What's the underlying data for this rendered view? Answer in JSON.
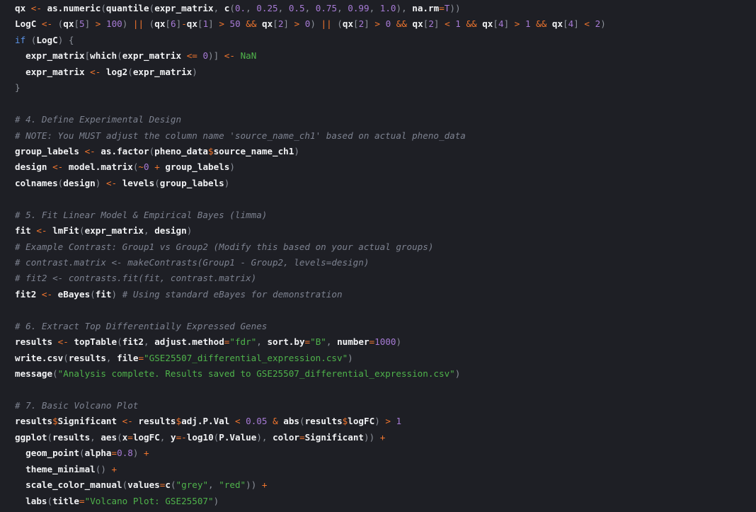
{
  "theme": {
    "background": "#1e1f25",
    "default": "#f2f3f5",
    "punctuation": "#8c919a",
    "operator": "#f2762e",
    "number": "#a77bd6",
    "string": "#4fb34b",
    "keyword": "#5b94e8",
    "comment": "#7d8290"
  },
  "lines": [
    [
      [
        "d",
        "qx "
      ],
      [
        "o",
        "<-"
      ],
      [
        "d",
        " as.numeric"
      ],
      [
        "p",
        "("
      ],
      [
        "d",
        "quantile"
      ],
      [
        "p",
        "("
      ],
      [
        "d",
        "expr_matrix"
      ],
      [
        "p",
        ", "
      ],
      [
        "d",
        "c"
      ],
      [
        "p",
        "("
      ],
      [
        "n",
        "0."
      ],
      [
        "p",
        ", "
      ],
      [
        "n",
        "0.25"
      ],
      [
        "p",
        ", "
      ],
      [
        "n",
        "0.5"
      ],
      [
        "p",
        ", "
      ],
      [
        "n",
        "0.75"
      ],
      [
        "p",
        ", "
      ],
      [
        "n",
        "0.99"
      ],
      [
        "p",
        ", "
      ],
      [
        "n",
        "1.0"
      ],
      [
        "p",
        "), "
      ],
      [
        "d",
        "na.rm"
      ],
      [
        "o",
        "="
      ],
      [
        "n",
        "T"
      ],
      [
        "p",
        "))"
      ]
    ],
    [
      [
        "d",
        "LogC "
      ],
      [
        "o",
        "<-"
      ],
      [
        "p",
        " ("
      ],
      [
        "d",
        "qx"
      ],
      [
        "p",
        "["
      ],
      [
        "n",
        "5"
      ],
      [
        "p",
        "] "
      ],
      [
        "o",
        ">"
      ],
      [
        "p",
        " "
      ],
      [
        "n",
        "100"
      ],
      [
        "p",
        ") "
      ],
      [
        "o",
        "||"
      ],
      [
        "p",
        " ("
      ],
      [
        "d",
        "qx"
      ],
      [
        "p",
        "["
      ],
      [
        "n",
        "6"
      ],
      [
        "p",
        "]"
      ],
      [
        "o",
        "-"
      ],
      [
        "d",
        "qx"
      ],
      [
        "p",
        "["
      ],
      [
        "n",
        "1"
      ],
      [
        "p",
        "] "
      ],
      [
        "o",
        ">"
      ],
      [
        "p",
        " "
      ],
      [
        "n",
        "50"
      ],
      [
        "p",
        " "
      ],
      [
        "o",
        "&&"
      ],
      [
        "p",
        " "
      ],
      [
        "d",
        "qx"
      ],
      [
        "p",
        "["
      ],
      [
        "n",
        "2"
      ],
      [
        "p",
        "] "
      ],
      [
        "o",
        ">"
      ],
      [
        "p",
        " "
      ],
      [
        "n",
        "0"
      ],
      [
        "p",
        ") "
      ],
      [
        "o",
        "||"
      ],
      [
        "p",
        " ("
      ],
      [
        "d",
        "qx"
      ],
      [
        "p",
        "["
      ],
      [
        "n",
        "2"
      ],
      [
        "p",
        "] "
      ],
      [
        "o",
        ">"
      ],
      [
        "p",
        " "
      ],
      [
        "n",
        "0"
      ],
      [
        "p",
        " "
      ],
      [
        "o",
        "&&"
      ],
      [
        "p",
        " "
      ],
      [
        "d",
        "qx"
      ],
      [
        "p",
        "["
      ],
      [
        "n",
        "2"
      ],
      [
        "p",
        "] "
      ],
      [
        "o",
        "<"
      ],
      [
        "p",
        " "
      ],
      [
        "n",
        "1"
      ],
      [
        "p",
        " "
      ],
      [
        "o",
        "&&"
      ],
      [
        "p",
        " "
      ],
      [
        "d",
        "qx"
      ],
      [
        "p",
        "["
      ],
      [
        "n",
        "4"
      ],
      [
        "p",
        "] "
      ],
      [
        "o",
        ">"
      ],
      [
        "p",
        " "
      ],
      [
        "n",
        "1"
      ],
      [
        "p",
        " "
      ],
      [
        "o",
        "&&"
      ],
      [
        "p",
        " "
      ],
      [
        "d",
        "qx"
      ],
      [
        "p",
        "["
      ],
      [
        "n",
        "4"
      ],
      [
        "p",
        "] "
      ],
      [
        "o",
        "<"
      ],
      [
        "p",
        " "
      ],
      [
        "n",
        "2"
      ],
      [
        "p",
        ")"
      ]
    ],
    [
      [
        "k",
        "if"
      ],
      [
        "p",
        " ("
      ],
      [
        "d",
        "LogC"
      ],
      [
        "p",
        ") {"
      ]
    ],
    [
      [
        "d",
        "  expr_matrix"
      ],
      [
        "p",
        "["
      ],
      [
        "d",
        "which"
      ],
      [
        "p",
        "("
      ],
      [
        "d",
        "expr_matrix "
      ],
      [
        "o",
        "<="
      ],
      [
        "p",
        " "
      ],
      [
        "n",
        "0"
      ],
      [
        "p",
        ")] "
      ],
      [
        "o",
        "<-"
      ],
      [
        "p",
        " "
      ],
      [
        "s",
        "NaN"
      ]
    ],
    [
      [
        "d",
        "  expr_matrix "
      ],
      [
        "o",
        "<-"
      ],
      [
        "d",
        " log2"
      ],
      [
        "p",
        "("
      ],
      [
        "d",
        "expr_matrix"
      ],
      [
        "p",
        ")"
      ]
    ],
    [
      [
        "p",
        "}"
      ]
    ],
    [],
    [
      [
        "c",
        "# 4. Define Experimental Design"
      ]
    ],
    [
      [
        "c",
        "# NOTE: You MUST adjust the column name 'source_name_ch1' based on actual pheno_data"
      ]
    ],
    [
      [
        "d",
        "group_labels "
      ],
      [
        "o",
        "<-"
      ],
      [
        "d",
        " as.factor"
      ],
      [
        "p",
        "("
      ],
      [
        "d",
        "pheno_data"
      ],
      [
        "o",
        "$"
      ],
      [
        "d",
        "source_name_ch1"
      ],
      [
        "p",
        ")"
      ]
    ],
    [
      [
        "d",
        "design "
      ],
      [
        "o",
        "<-"
      ],
      [
        "d",
        " model.matrix"
      ],
      [
        "p",
        "("
      ],
      [
        "o",
        "~"
      ],
      [
        "n",
        "0"
      ],
      [
        "p",
        " "
      ],
      [
        "o",
        "+"
      ],
      [
        "p",
        " "
      ],
      [
        "d",
        "group_labels"
      ],
      [
        "p",
        ")"
      ]
    ],
    [
      [
        "d",
        "colnames"
      ],
      [
        "p",
        "("
      ],
      [
        "d",
        "design"
      ],
      [
        "p",
        ") "
      ],
      [
        "o",
        "<-"
      ],
      [
        "d",
        " levels"
      ],
      [
        "p",
        "("
      ],
      [
        "d",
        "group_labels"
      ],
      [
        "p",
        ")"
      ]
    ],
    [],
    [
      [
        "c",
        "# 5. Fit Linear Model & Empirical Bayes (limma)"
      ]
    ],
    [
      [
        "d",
        "fit "
      ],
      [
        "o",
        "<-"
      ],
      [
        "d",
        " lmFit"
      ],
      [
        "p",
        "("
      ],
      [
        "d",
        "expr_matrix"
      ],
      [
        "p",
        ", "
      ],
      [
        "d",
        "design"
      ],
      [
        "p",
        ")"
      ]
    ],
    [
      [
        "c",
        "# Example Contrast: Group1 vs Group2 (Modify this based on your actual groups)"
      ]
    ],
    [
      [
        "c",
        "# contrast.matrix <- makeContrasts(Group1 - Group2, levels=design)"
      ]
    ],
    [
      [
        "c",
        "# fit2 <- contrasts.fit(fit, contrast.matrix)"
      ]
    ],
    [
      [
        "d",
        "fit2 "
      ],
      [
        "o",
        "<-"
      ],
      [
        "d",
        " eBayes"
      ],
      [
        "p",
        "("
      ],
      [
        "d",
        "fit"
      ],
      [
        "p",
        ") "
      ],
      [
        "c",
        "# Using standard eBayes for demonstration"
      ]
    ],
    [],
    [
      [
        "c",
        "# 6. Extract Top Differentially Expressed Genes"
      ]
    ],
    [
      [
        "d",
        "results "
      ],
      [
        "o",
        "<-"
      ],
      [
        "d",
        " topTable"
      ],
      [
        "p",
        "("
      ],
      [
        "d",
        "fit2"
      ],
      [
        "p",
        ", "
      ],
      [
        "d",
        "adjust.method"
      ],
      [
        "o",
        "="
      ],
      [
        "s",
        "\"fdr\""
      ],
      [
        "p",
        ", "
      ],
      [
        "d",
        "sort.by"
      ],
      [
        "o",
        "="
      ],
      [
        "s",
        "\"B\""
      ],
      [
        "p",
        ", "
      ],
      [
        "d",
        "number"
      ],
      [
        "o",
        "="
      ],
      [
        "n",
        "1000"
      ],
      [
        "p",
        ")"
      ]
    ],
    [
      [
        "d",
        "write.csv"
      ],
      [
        "p",
        "("
      ],
      [
        "d",
        "results"
      ],
      [
        "p",
        ", "
      ],
      [
        "d",
        "file"
      ],
      [
        "o",
        "="
      ],
      [
        "s",
        "\"GSE25507_differential_expression.csv\""
      ],
      [
        "p",
        ")"
      ]
    ],
    [
      [
        "d",
        "message"
      ],
      [
        "p",
        "("
      ],
      [
        "s",
        "\"Analysis complete. Results saved to GSE25507_differential_expression.csv\""
      ],
      [
        "p",
        ")"
      ]
    ],
    [],
    [
      [
        "c",
        "# 7. Basic Volcano Plot"
      ]
    ],
    [
      [
        "d",
        "results"
      ],
      [
        "o",
        "$"
      ],
      [
        "d",
        "Significant "
      ],
      [
        "o",
        "<-"
      ],
      [
        "d",
        " results"
      ],
      [
        "o",
        "$"
      ],
      [
        "d",
        "adj.P.Val "
      ],
      [
        "o",
        "<"
      ],
      [
        "p",
        " "
      ],
      [
        "n",
        "0.05"
      ],
      [
        "p",
        " "
      ],
      [
        "o",
        "&"
      ],
      [
        "d",
        " abs"
      ],
      [
        "p",
        "("
      ],
      [
        "d",
        "results"
      ],
      [
        "o",
        "$"
      ],
      [
        "d",
        "logFC"
      ],
      [
        "p",
        ") "
      ],
      [
        "o",
        ">"
      ],
      [
        "p",
        " "
      ],
      [
        "n",
        "1"
      ]
    ],
    [
      [
        "d",
        "ggplot"
      ],
      [
        "p",
        "("
      ],
      [
        "d",
        "results"
      ],
      [
        "p",
        ", "
      ],
      [
        "d",
        "aes"
      ],
      [
        "p",
        "("
      ],
      [
        "d",
        "x"
      ],
      [
        "o",
        "="
      ],
      [
        "d",
        "logFC"
      ],
      [
        "p",
        ", "
      ],
      [
        "d",
        "y"
      ],
      [
        "o",
        "=-"
      ],
      [
        "d",
        "log10"
      ],
      [
        "p",
        "("
      ],
      [
        "d",
        "P.Value"
      ],
      [
        "p",
        "), "
      ],
      [
        "d",
        "color"
      ],
      [
        "o",
        "="
      ],
      [
        "d",
        "Significant"
      ],
      [
        "p",
        "))"
      ],
      [
        "p",
        " "
      ],
      [
        "o",
        "+"
      ]
    ],
    [
      [
        "d",
        "  geom_point"
      ],
      [
        "p",
        "("
      ],
      [
        "d",
        "alpha"
      ],
      [
        "o",
        "="
      ],
      [
        "n",
        "0.8"
      ],
      [
        "p",
        ") "
      ],
      [
        "o",
        "+"
      ]
    ],
    [
      [
        "d",
        "  theme_minimal"
      ],
      [
        "p",
        "() "
      ],
      [
        "o",
        "+"
      ]
    ],
    [
      [
        "d",
        "  scale_color_manual"
      ],
      [
        "p",
        "("
      ],
      [
        "d",
        "values"
      ],
      [
        "o",
        "="
      ],
      [
        "d",
        "c"
      ],
      [
        "p",
        "("
      ],
      [
        "s",
        "\"grey\""
      ],
      [
        "p",
        ", "
      ],
      [
        "s",
        "\"red\""
      ],
      [
        "p",
        "))"
      ],
      [
        "p",
        " "
      ],
      [
        "o",
        "+"
      ]
    ],
    [
      [
        "d",
        "  labs"
      ],
      [
        "p",
        "("
      ],
      [
        "d",
        "title"
      ],
      [
        "o",
        "="
      ],
      [
        "s",
        "\"Volcano Plot: GSE25507\""
      ],
      [
        "p",
        ")"
      ]
    ]
  ]
}
